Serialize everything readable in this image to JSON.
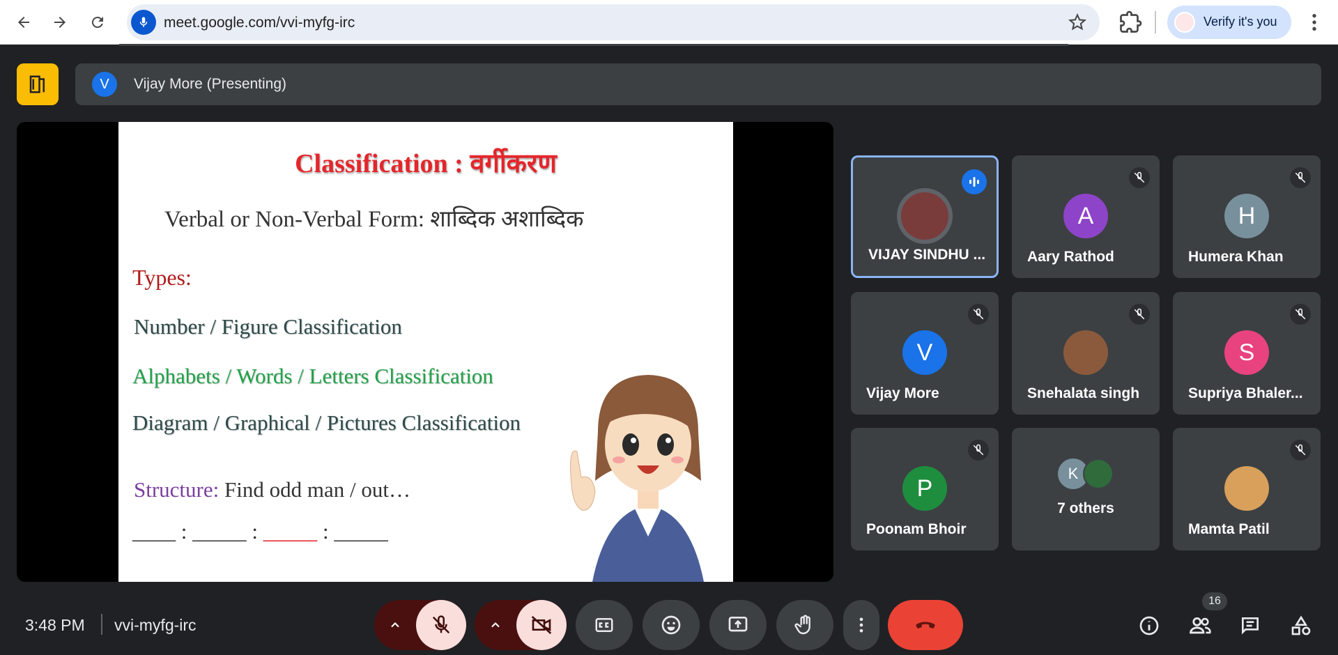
{
  "browser": {
    "url": "meet.google.com/vvi-myfg-irc",
    "verify_label": "Verify it's you"
  },
  "meet": {
    "presenter": {
      "initial": "V",
      "label": "Vijay More (Presenting)"
    },
    "slide": {
      "title": "Classification : वर्गीकरण",
      "subtitle": "Verbal or Non-Verbal Form:  शाब्दिक अशाब्दिक",
      "types_label": "Types:",
      "items": [
        "Number / Figure Classification",
        "Alphabets / Words / Letters Classification",
        "Diagram / Graphical / Pictures Classification"
      ],
      "structure_label": "Structure:",
      "structure_text": " Find odd man / out…",
      "blanks": [
        "____ : _____ ",
        " : ",
        "_____",
        " : _____"
      ]
    },
    "participants": [
      {
        "name": "VIJAY SINDHU ...",
        "initial": "",
        "color": "#7a3b3b",
        "speaking": true
      },
      {
        "name": "Aary Rathod",
        "initial": "A",
        "color": "#8e44c9",
        "speaking": false
      },
      {
        "name": "Humera Khan",
        "initial": "H",
        "color": "#78909c",
        "speaking": false
      },
      {
        "name": "Vijay More",
        "initial": "V",
        "color": "#1a73e8",
        "speaking": false
      },
      {
        "name": "Snehalata singh",
        "initial": "",
        "color": "#8b5a3c",
        "speaking": false
      },
      {
        "name": "Supriya Bhaler...",
        "initial": "S",
        "color": "#e8437e",
        "speaking": false
      },
      {
        "name": "Poonam Bhoir",
        "initial": "P",
        "color": "#1e8e3e",
        "speaking": false
      },
      {
        "name": "7 others",
        "initial": "K",
        "color": "#78909c",
        "speaking": false
      },
      {
        "name": "Mamta Patil",
        "initial": "",
        "color": "#d8a05a",
        "speaking": false
      }
    ],
    "footer": {
      "time": "3:48 PM",
      "meeting_code": "vvi-myfg-irc",
      "people_count": "16"
    }
  },
  "colors": {
    "accent": "#1a73e8",
    "end_call": "#ea4335",
    "mic_off_bg": "#f9dedc"
  }
}
